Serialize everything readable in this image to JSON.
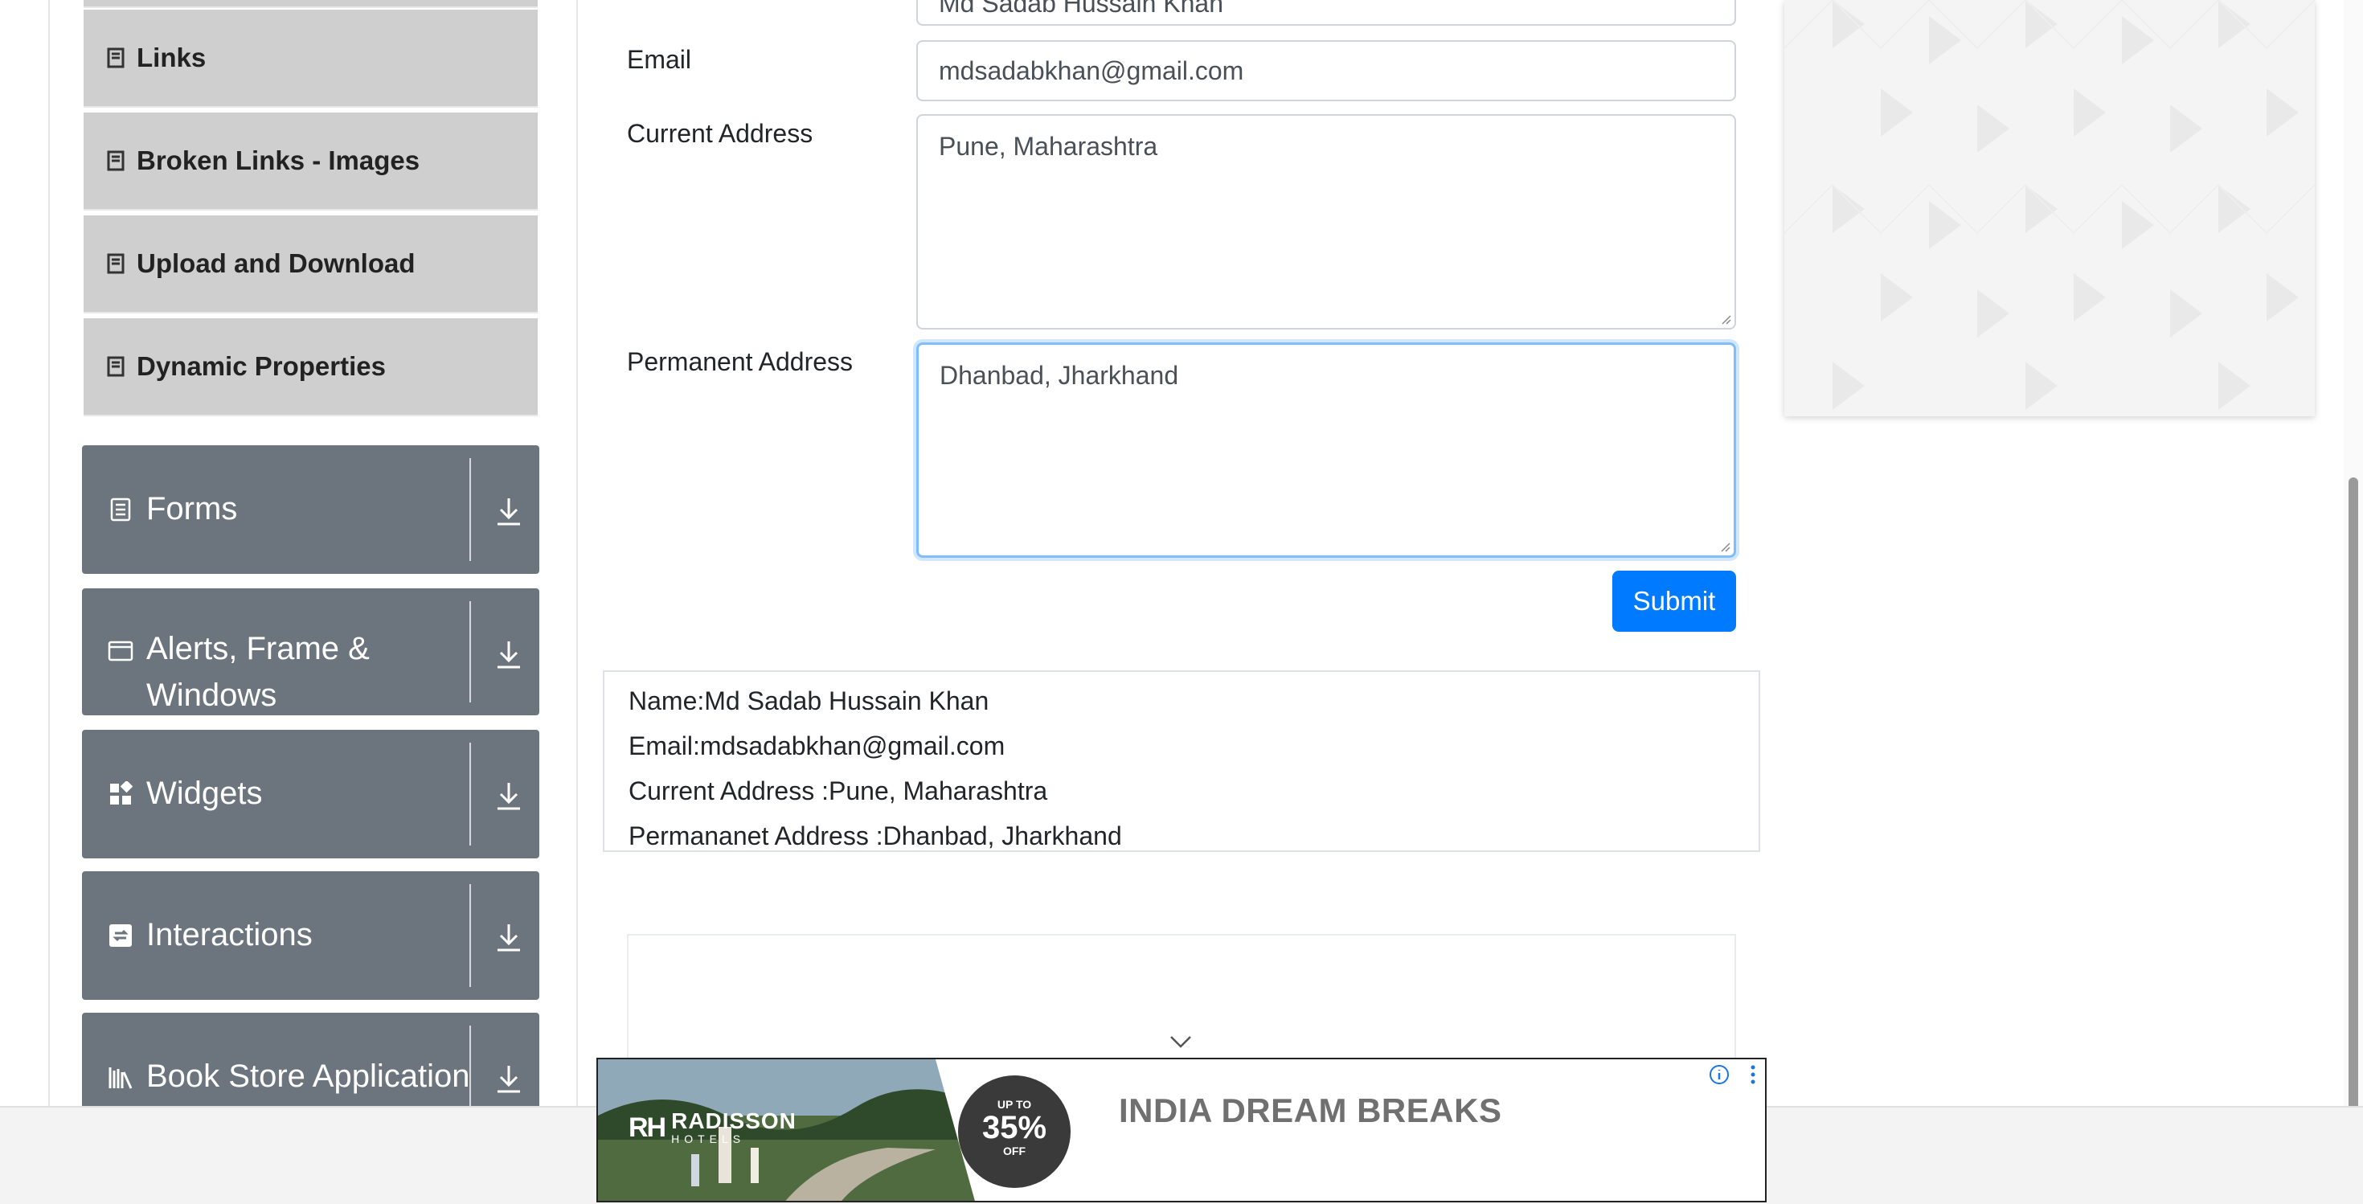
{
  "sidebar": {
    "elements_items": [
      {
        "label": "Links",
        "icon": "book-icon"
      },
      {
        "label": "Broken Links - Images",
        "icon": "book-icon"
      },
      {
        "label": "Upload and Download",
        "icon": "book-icon"
      },
      {
        "label": "Dynamic Properties",
        "icon": "book-icon"
      }
    ],
    "groups": [
      {
        "label": "Forms",
        "icon": "document-icon"
      },
      {
        "label": "Alerts, Frame & Windows",
        "line1": "Alerts, Frame &",
        "line2": "Windows",
        "icon": "window-icon"
      },
      {
        "label": "Widgets",
        "icon": "widgets-icon"
      },
      {
        "label": "Interactions",
        "icon": "interactions-icon"
      },
      {
        "label": "Book Store Application",
        "icon": "books-icon"
      }
    ]
  },
  "form": {
    "full_name_value": "Md Sadab Hussain Khan",
    "email_label": "Email",
    "email_value": "mdsadabkhan@gmail.com",
    "current_address_label": "Current Address",
    "current_address_value": "Pune, Maharashtra",
    "permanent_address_label": "Permanent Address",
    "permanent_address_value": "Dhanbad, Jharkhand",
    "submit_label": "Submit"
  },
  "output": {
    "name": "Name:Md Sadab Hussain Khan",
    "email": "Email:mdsadabkhan@gmail.com",
    "current_address": "Current Address :Pune, Maharashtra",
    "permanent_address": "Permananet Address :Dhanbad, Jharkhand"
  },
  "banner_ad": {
    "brand": "RADISSON",
    "brand_sub": "HOTELS",
    "badge_top": "UP TO",
    "badge_pct": "35%",
    "badge_bottom": "OFF",
    "headline": "INDIA DREAM BREAKS"
  },
  "colors": {
    "primary": "#007bff",
    "sidebar_group": "#6c757d",
    "sidebar_item": "#cfcfcf",
    "focus_border": "#80bdff"
  }
}
